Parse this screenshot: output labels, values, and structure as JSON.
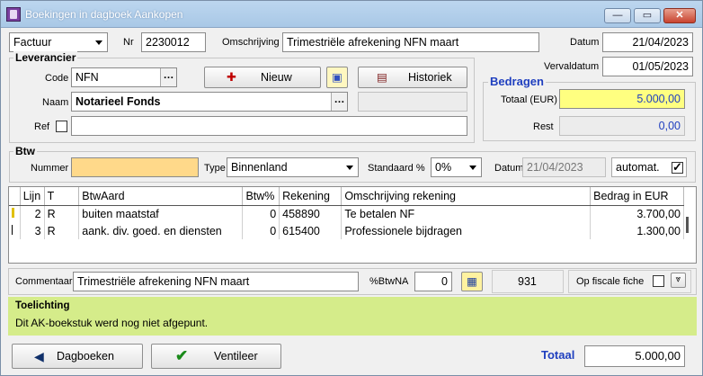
{
  "window": {
    "title": "Boekingen in dagboek Aankopen",
    "minimize": "—",
    "maximize": "▭",
    "close": "✕"
  },
  "header": {
    "doc_type": "Factuur",
    "nr_label": "Nr",
    "nr_value": "2230012",
    "omschrijving_label": "Omschrijving",
    "omschrijving_value": "Trimestriële afrekening NFN maart",
    "datum_label": "Datum",
    "datum_value": "21/04/2023",
    "vervaldatum_label": "Vervaldatum",
    "vervaldatum_value": "01/05/2023"
  },
  "leverancier": {
    "title": "Leverancier",
    "code_label": "Code",
    "code_value": "NFN",
    "naam_label": "Naam",
    "naam_value": "Notarieel Fonds",
    "ref_label": "Ref",
    "nieuw_label": "Nieuw",
    "historiek_label": "Historiek"
  },
  "bedragen": {
    "title": "Bedragen",
    "totaal_label": "Totaal (EUR)",
    "totaal_value": "5.000,00",
    "rest_label": "Rest",
    "rest_value": "0,00"
  },
  "btw": {
    "title": "Btw",
    "nummer_label": "Nummer",
    "nummer_value": "",
    "type_label": "Type",
    "type_value": "Binnenland",
    "standaard_label": "Standaard %",
    "standaard_value": "0%",
    "datum_label": "Datum",
    "datum_value": "21/04/2023",
    "automat_label": "automat.",
    "automat_checked": true
  },
  "grid": {
    "columns": [
      "Lijn",
      "T",
      "BtwAard",
      "Btw%",
      "Rekening",
      "Omschrijving rekening",
      "Bedrag in EUR"
    ],
    "rows": [
      {
        "lijn": "2",
        "t": "R",
        "btwaard": "buiten maatstaf",
        "btw": "0",
        "rekening": "458890",
        "omschrijving": "Te betalen NF",
        "bedrag": "3.700,00"
      },
      {
        "lijn": "3",
        "t": "R",
        "btwaard": "aank. div. goed. en diensten",
        "btw": "0",
        "rekening": "615400",
        "omschrijving": "Professionele bijdragen",
        "bedrag": "1.300,00"
      }
    ]
  },
  "footer": {
    "commentaar_label": "Commentaar",
    "commentaar_value": "Trimestriële afrekening NFN maart",
    "btwna_label": "%BtwNA",
    "btwna_value": "0",
    "count_value": "931",
    "fiscale_label": "Op fiscale fiche"
  },
  "toelichting": {
    "title": "Toelichting",
    "text": "Dit AK-boekstuk werd nog niet afgepunt."
  },
  "actions": {
    "dagboeken_label": "Dagboeken",
    "ventileer_label": "Ventileer",
    "totaal_label": "Totaal",
    "totaal_value": "5.000,00"
  },
  "colors": {
    "accent_blue": "#1f3fbf",
    "yellow_field": "#ffff80",
    "orange_field": "#ffd98a",
    "info_green": "#d5ec8a"
  }
}
